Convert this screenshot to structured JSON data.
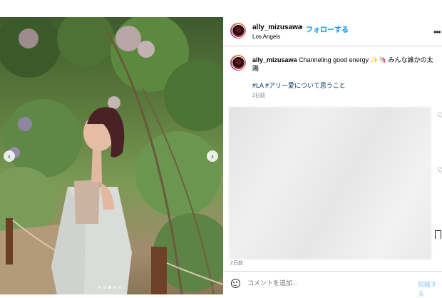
{
  "photo": {
    "nav_prev_icon": "chevron-left-icon",
    "nav_next_icon": "chevron-right-icon",
    "nav_prev_glyph": "‹",
    "nav_next_glyph": "›",
    "page_count": 5,
    "active_page": 3
  },
  "header": {
    "username": "ally_mizusawa",
    "separator": "•",
    "follow_label": "フォローする",
    "location": "Los Angels",
    "more_glyph": "•••"
  },
  "caption": {
    "username": "ally_mizusawa",
    "text": "Channeling good energy ✨🦄 みんな誰かの太陽",
    "hashtags": "#LA #アリー愛について思うこと",
    "date": "2日前"
  },
  "sidebar_icons": {
    "heart_glyph": "♡",
    "icons": [
      "heart-icon",
      "heart-icon",
      "bookmark-icon"
    ]
  },
  "footer": {
    "date": "2日前",
    "comment_placeholder": "コメントを追加...",
    "post_label": "投稿する"
  },
  "colors": {
    "link_blue": "#0095f6",
    "hashtag_blue": "#00376b",
    "post_disabled": "#b3dbff",
    "muted": "#737373"
  }
}
